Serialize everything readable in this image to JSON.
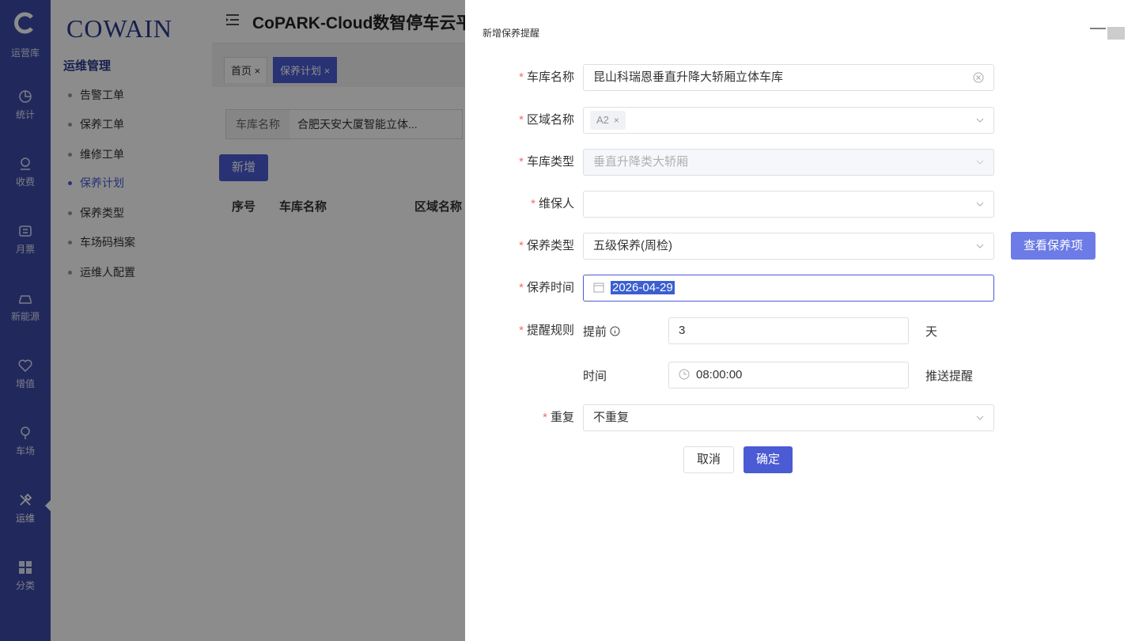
{
  "rail": {
    "items": [
      {
        "label": "运营库",
        "icon": "home-icon"
      },
      {
        "label": "统计",
        "icon": "chart-icon"
      },
      {
        "label": "收费",
        "icon": "money-icon"
      },
      {
        "label": "月票",
        "icon": "ticket-icon"
      },
      {
        "label": "新能源",
        "icon": "car-icon"
      },
      {
        "label": "增值",
        "icon": "heart-icon"
      },
      {
        "label": "车场",
        "icon": "location-icon"
      },
      {
        "label": "运维",
        "icon": "tools-icon"
      },
      {
        "label": "分类",
        "icon": "grid-icon"
      }
    ]
  },
  "subnav": {
    "brand": "COWAIN",
    "section_title": "运维管理",
    "items": [
      "告警工单",
      "保养工单",
      "维修工单",
      "保养计划",
      "保养类型",
      "车场码档案",
      "运维人配置"
    ],
    "active": "保养计划"
  },
  "header": {
    "title": "CoPARK-Cloud数智停车云平台"
  },
  "tabs": [
    {
      "label": "首页",
      "close": "×"
    },
    {
      "label": "保养计划",
      "close": "×"
    }
  ],
  "main": {
    "filter_label": "车库名称",
    "filter_value": "合肥天安大厦智能立体...",
    "add_button": "新增",
    "columns": [
      "序号",
      "车库名称",
      "区域名称"
    ]
  },
  "drawer": {
    "title": "新增保养提醒",
    "fields": {
      "garage_label": "车库名称",
      "garage_value": "昆山科瑞恩垂直升降大轿厢立体车库",
      "area_label": "区域名称",
      "area_tag": "A2",
      "type_label": "车库类型",
      "type_value": "垂直升降类大轿厢",
      "maintainer_label": "维保人",
      "maintainer_value": "",
      "mtype_label": "保养类型",
      "mtype_value": "五级保养(周检)",
      "view_button": "查看保养项",
      "time_label": "保养时间",
      "time_value": "2026-04-29",
      "rule_label": "提醒规则",
      "advance_label": "提前",
      "advance_value": "3",
      "advance_unit": "天",
      "clock_label": "时间",
      "clock_value": "08:00:00",
      "push_label": "推送提醒",
      "repeat_label": "重复",
      "repeat_value": "不重复"
    },
    "cancel_button": "取消",
    "ok_button": "确定"
  },
  "colors": {
    "brand": "#3d4ba8",
    "primary": "#4a5bd4",
    "required": "#f56c6c"
  }
}
